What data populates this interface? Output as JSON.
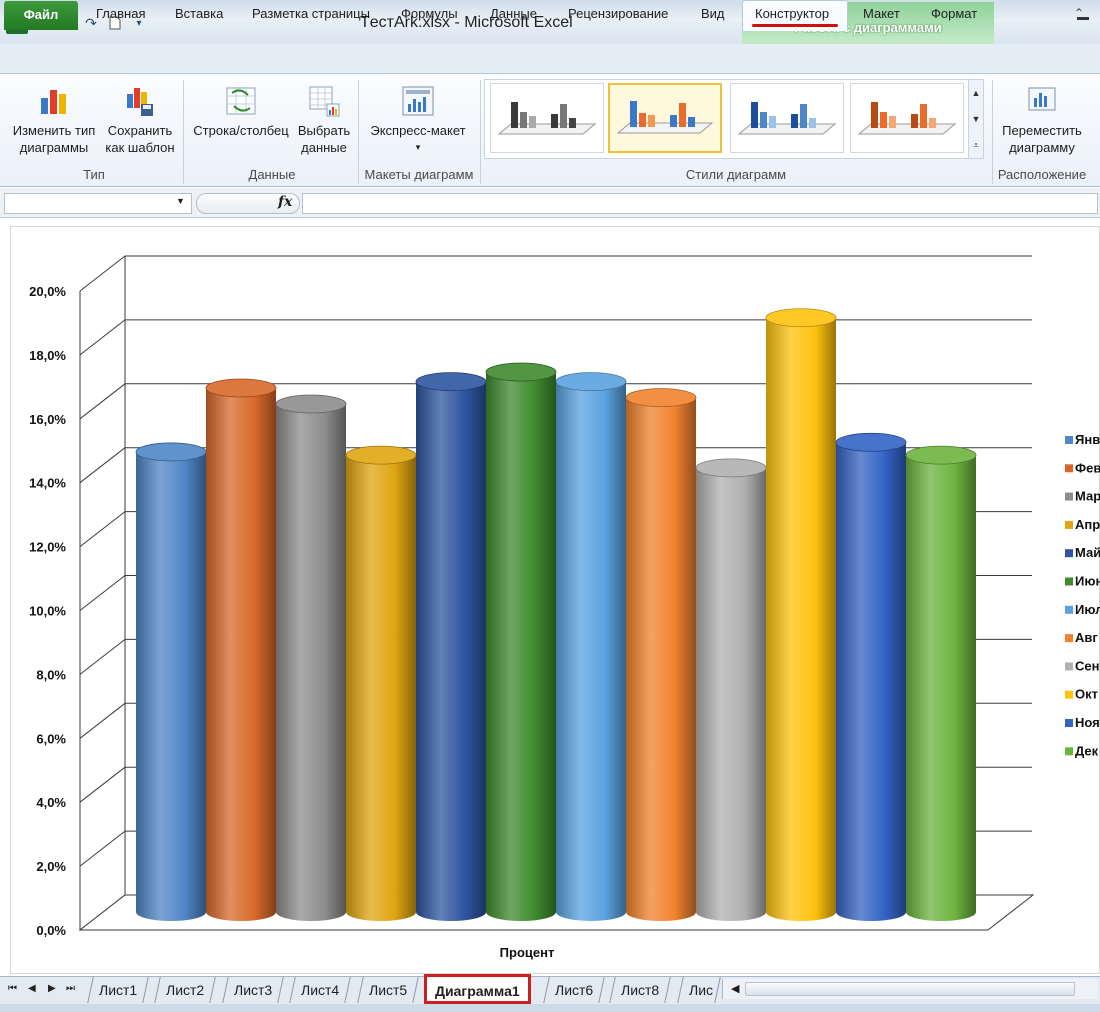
{
  "window": {
    "title": "TестArk.xlsx  -  Microsoft Excel",
    "context_group": "Работа с диаграммами"
  },
  "tabs": {
    "file": "Файл",
    "items": [
      "Главная",
      "Вставка",
      "Разметка страницы",
      "Формулы",
      "Данные",
      "Рецензирование",
      "Вид"
    ],
    "active": "Конструктор",
    "context_items": [
      "Макет",
      "Формат"
    ]
  },
  "ribbon": {
    "change_type": [
      "Изменить тип",
      "диаграммы"
    ],
    "save_template": [
      "Сохранить",
      "как шаблон"
    ],
    "group_type": "Тип",
    "row_column": "Строка/столбец",
    "select_data": [
      "Выбрать",
      "данные"
    ],
    "group_data": "Данные",
    "express_layout": "Экспресс-макет",
    "group_layouts": "Макеты диаграмм",
    "group_styles": "Стили диаграмм",
    "move_chart": [
      "Переместить",
      "диаграмму"
    ],
    "group_location": "Расположение"
  },
  "formula_bar": {
    "fx": "fx"
  },
  "chart_data": {
    "type": "bar",
    "xlabel": "Процент",
    "ylim": [
      0,
      20
    ],
    "ytick_labels": [
      "0,0%",
      "2,0%",
      "4,0%",
      "6,0%",
      "8,0%",
      "10,0%",
      "12,0%",
      "14,0%",
      "16,0%",
      "18,0%",
      "20,0%"
    ],
    "series": [
      {
        "name": "Янв",
        "value": 14.4,
        "color": "#4f86c6"
      },
      {
        "name": "Фев",
        "value": 16.4,
        "color": "#d8682a"
      },
      {
        "name": "Мар",
        "value": 15.9,
        "color": "#8c8c8c"
      },
      {
        "name": "Апр",
        "value": 14.3,
        "color": "#e0a510"
      },
      {
        "name": "Май",
        "value": 16.6,
        "color": "#2d55a0"
      },
      {
        "name": "Июн",
        "value": 16.9,
        "color": "#3f8a2e"
      },
      {
        "name": "Июл",
        "value": 16.6,
        "color": "#5aa2e0"
      },
      {
        "name": "Авг",
        "value": 16.1,
        "color": "#f0822e"
      },
      {
        "name": "Сен",
        "value": 13.9,
        "color": "#b0b0b0"
      },
      {
        "name": "Окт",
        "value": 18.6,
        "color": "#ffc20e"
      },
      {
        "name": "Ноя",
        "value": 14.7,
        "color": "#3463c4"
      },
      {
        "name": "Дек",
        "value": 14.3,
        "color": "#6cb33f"
      }
    ],
    "grid": true,
    "legend": "right"
  },
  "sheet_tabs": [
    "Лист1",
    "Лист2",
    "Лист3",
    "Лист4",
    "Лист5",
    "Диаграмма1",
    "Лист6",
    "Лист8",
    "Лис"
  ],
  "active_sheet": "Диаграмма1"
}
